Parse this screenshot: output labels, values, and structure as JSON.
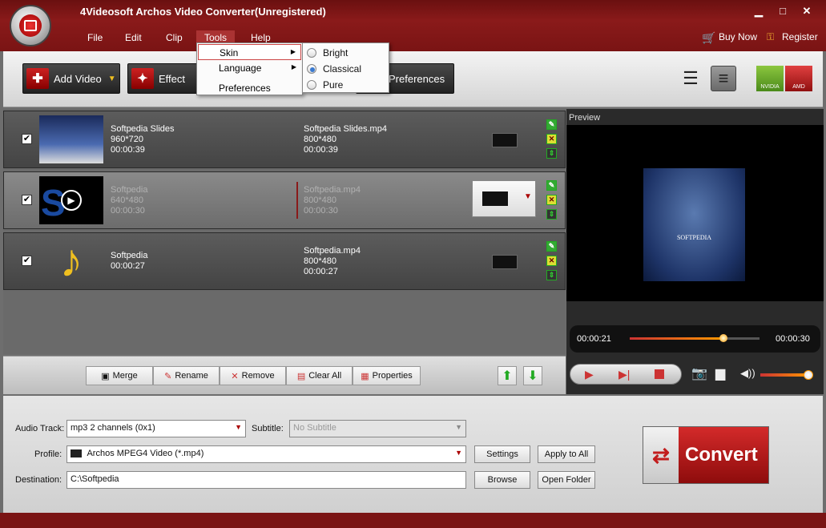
{
  "window": {
    "title": "4Videosoft Archos Video Converter(Unregistered)",
    "minimize": "▁",
    "restore": "□",
    "close": "✕"
  },
  "menubar": {
    "items": [
      "File",
      "Edit",
      "Clip",
      "Tools",
      "Help"
    ]
  },
  "topright": {
    "buy_now": "Buy Now",
    "register": "Register"
  },
  "toolbar": {
    "add_video": "Add Video",
    "effect": "Effect",
    "preferences": "Preferences",
    "nvidia": "NVIDIA",
    "amd": "AMD"
  },
  "tools_menu": {
    "items": [
      "Skin",
      "Language",
      "Preferences"
    ]
  },
  "skin_submenu": {
    "items": [
      "Bright",
      "Classical",
      "Pure"
    ],
    "selected": "Classical"
  },
  "files": [
    {
      "name": "Softpedia Slides",
      "resolution": "960*720",
      "duration": "00:00:39",
      "output_name": "Softpedia Slides.mp4",
      "output_resolution": "800*480",
      "output_duration": "00:00:39",
      "checked": true
    },
    {
      "name": "Softpedia",
      "resolution": "640*480",
      "duration": "00:00:30",
      "output_name": "Softpedia.mp4",
      "output_resolution": "800*480",
      "output_duration": "00:00:30",
      "checked": true
    },
    {
      "name": "Softpedia",
      "resolution": "",
      "duration": "00:00:27",
      "output_name": "Softpedia.mp4",
      "output_resolution": "800*480",
      "output_duration": "00:00:27",
      "checked": true
    }
  ],
  "preview": {
    "label": "Preview",
    "watermark": "SOFTPEDIA",
    "current_time": "00:00:21",
    "total_time": "00:00:30",
    "progress": 0.72,
    "volume": 1.0
  },
  "bottom_buttons": {
    "merge": "Merge",
    "rename": "Rename",
    "remove": "Remove",
    "clear_all": "Clear All",
    "properties": "Properties"
  },
  "settings": {
    "audio_track_label": "Audio Track:",
    "audio_track_value": "mp3 2 channels (0x1)",
    "subtitle_label": "Subtitle:",
    "subtitle_value": "No Subtitle",
    "profile_label": "Profile:",
    "profile_value": "Archos MPEG4 Video (*.mp4)",
    "destination_label": "Destination:",
    "destination_value": "C:\\Softpedia",
    "settings_btn": "Settings",
    "apply_all_btn": "Apply to All",
    "browse_btn": "Browse",
    "open_folder_btn": "Open Folder"
  },
  "convert": {
    "label": "Convert"
  },
  "colors": {
    "accent": "#8a1a1a",
    "convert": "#c21d1d"
  }
}
